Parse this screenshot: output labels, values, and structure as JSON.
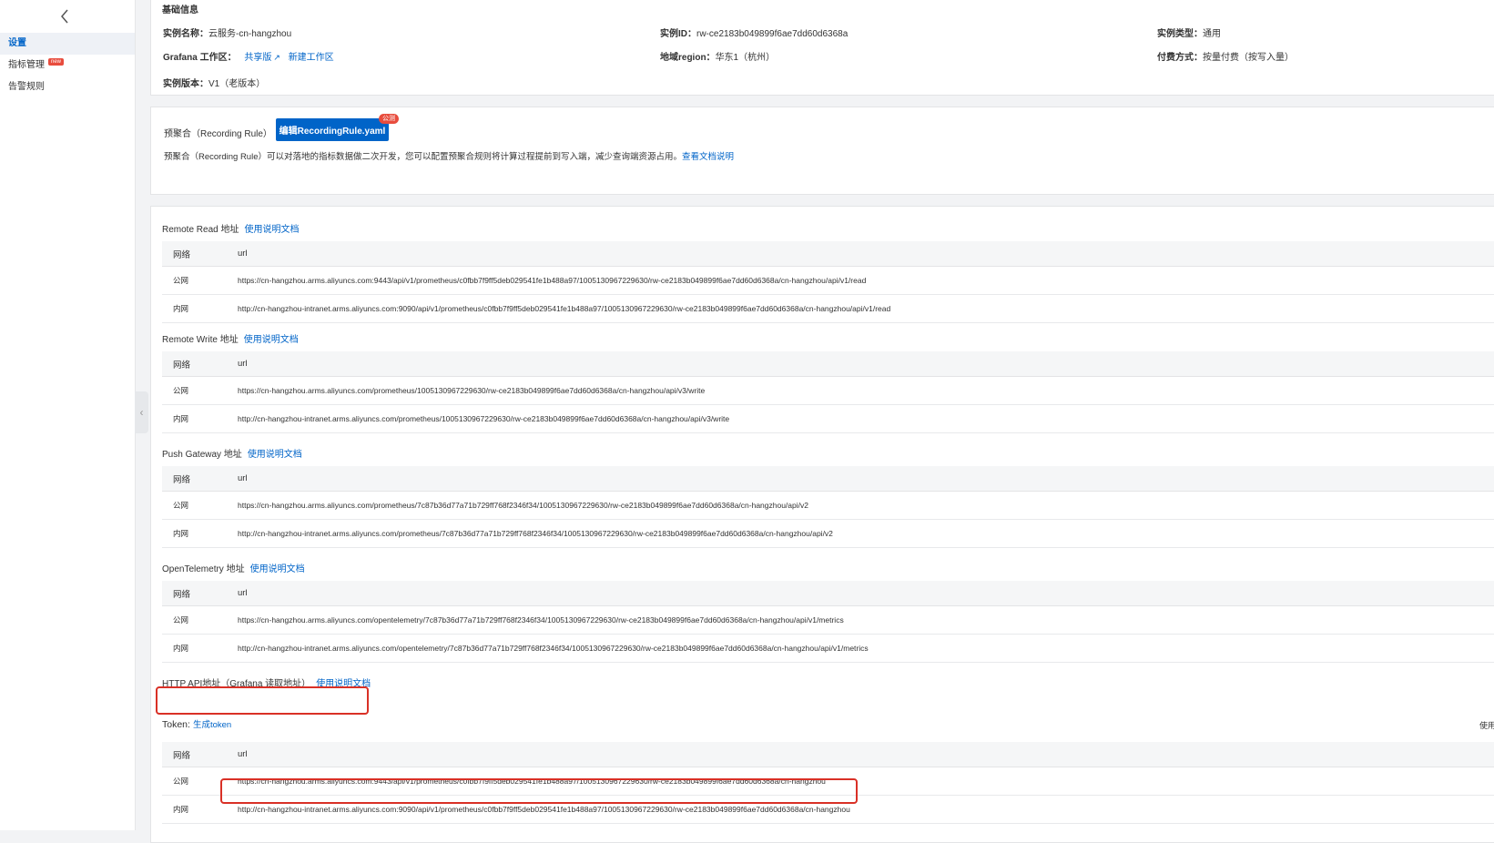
{
  "sidebar": {
    "back_icon": "chevron-left-icon",
    "items": [
      {
        "label": "设置",
        "active": true
      },
      {
        "label": "指标管理",
        "badge": "new"
      },
      {
        "label": "告警规则"
      }
    ]
  },
  "basic_info": {
    "title": "基础信息",
    "instance_name_key": "实例名称：",
    "instance_name_val": "云服务-cn-hangzhou",
    "instance_id_key": "实例ID：",
    "instance_id_val": "rw-ce2183b049899f6ae7dd60d6368a",
    "instance_type_key": "实例类型：",
    "instance_type_val": "通用",
    "grafana_key": "Grafana 工作区：",
    "grafana_shared": "共享版",
    "grafana_new": "新建工作区",
    "region_key": "地域region：",
    "region_val": "华东1（杭州）",
    "billing_key": "付费方式：",
    "billing_val": "按量付费（按写入量）",
    "version_key": "实例版本：",
    "version_val": "V1（老版本）"
  },
  "recording_rule": {
    "label": "预聚合（Recording Rule）",
    "button": "编辑RecordingRule.yaml",
    "badge": "公测",
    "desc": "预聚合（Recording Rule）可以对落地的指标数据做二次开发，您可以配置预聚合规则将计算过程提前到写入端，减少查询端资源占用。",
    "doc_link": "查看文档说明"
  },
  "columns": {
    "network": "网络",
    "url": "url"
  },
  "sections": [
    {
      "title": "Remote Read 地址",
      "link": "使用说明文档",
      "rows": [
        {
          "net": "公网",
          "url": "https://cn-hangzhou.arms.aliyuncs.com:9443/api/v1/prometheus/c0fbb7f9ff5deb029541fe1b488a97/1005130967229630/rw-ce2183b049899f6ae7dd60d6368a/cn-hangzhou/api/v1/read"
        },
        {
          "net": "内网",
          "url": "http://cn-hangzhou-intranet.arms.aliyuncs.com:9090/api/v1/prometheus/c0fbb7f9ff5deb029541fe1b488a97/1005130967229630/rw-ce2183b049899f6ae7dd60d6368a/cn-hangzhou/api/v1/read"
        }
      ]
    },
    {
      "title": "Remote Write 地址",
      "link": "使用说明文档",
      "rows": [
        {
          "net": "公网",
          "url": "https://cn-hangzhou.arms.aliyuncs.com/prometheus/1005130967229630/rw-ce2183b049899f6ae7dd60d6368a/cn-hangzhou/api/v3/write"
        },
        {
          "net": "内网",
          "url": "http://cn-hangzhou-intranet.arms.aliyuncs.com/prometheus/1005130967229630/rw-ce2183b049899f6ae7dd60d6368a/cn-hangzhou/api/v3/write"
        }
      ]
    },
    {
      "title": "Push Gateway 地址",
      "link": "使用说明文档",
      "rows": [
        {
          "net": "公网",
          "url": "https://cn-hangzhou.arms.aliyuncs.com/prometheus/7c87b36d77a71b729ff768f2346f34/1005130967229630/rw-ce2183b049899f6ae7dd60d6368a/cn-hangzhou/api/v2"
        },
        {
          "net": "内网",
          "url": "http://cn-hangzhou-intranet.arms.aliyuncs.com/prometheus/7c87b36d77a71b729ff768f2346f34/1005130967229630/rw-ce2183b049899f6ae7dd60d6368a/cn-hangzhou/api/v2"
        }
      ]
    },
    {
      "title": "OpenTelemetry 地址",
      "link": "使用说明文档",
      "rows": [
        {
          "net": "公网",
          "url": "https://cn-hangzhou.arms.aliyuncs.com/opentelemetry/7c87b36d77a71b729ff768f2346f34/1005130967229630/rw-ce2183b049899f6ae7dd60d6368a/cn-hangzhou/api/v1/metrics"
        },
        {
          "net": "内网",
          "url": "http://cn-hangzhou-intranet.arms.aliyuncs.com/opentelemetry/7c87b36d77a71b729ff768f2346f34/1005130967229630/rw-ce2183b049899f6ae7dd60d6368a/cn-hangzhou/api/v1/metrics"
        }
      ]
    }
  ],
  "http_api": {
    "title": "HTTP API地址（Grafana 读取地址）",
    "link": "使用说明文档",
    "token_label": "Token:",
    "token_link": "生成token",
    "right_edge_text": "使用",
    "rows": [
      {
        "net": "公网",
        "url": "https://cn-hangzhou.arms.aliyuncs.com:9443/api/v1/prometheus/c0fbb7f9ff5deb029541fe1b488a97/1005130967229630/rw-ce2183b049899f6ae7dd60d6368a/cn-hangzhou"
      },
      {
        "net": "内网",
        "url": "http://cn-hangzhou-intranet.arms.aliyuncs.com:9090/api/v1/prometheus/c0fbb7f9ff5deb029541fe1b488a97/1005130967229630/rw-ce2183b049899f6ae7dd60d6368a/cn-hangzhou"
      }
    ]
  },
  "colors": {
    "accent": "#0064c8",
    "highlight": "#d93026",
    "badge": "#e84c3d"
  }
}
